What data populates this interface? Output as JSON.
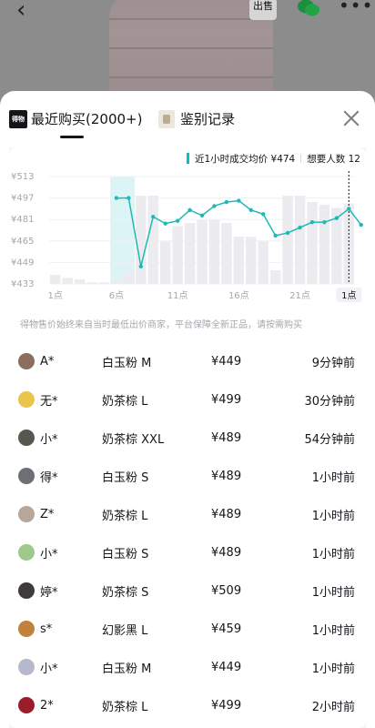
{
  "header": {
    "back_icon": "chevron-left-icon",
    "sell_label": "出售",
    "share_icon": "wechat-icon",
    "more_icon": "more-icon"
  },
  "tabs": {
    "recent": {
      "logo_text": "得物",
      "label": "最近购买(2000+)",
      "active": true
    },
    "auth": {
      "label": "鉴别记录"
    }
  },
  "chart_data": {
    "type": "line",
    "legend": {
      "avg_label": "近1小时成交均价 ¥474",
      "want_label": "想要人数 12"
    },
    "yticks": [
      "¥513",
      "¥497",
      "¥481",
      "¥465",
      "¥449",
      "¥433"
    ],
    "ylim": [
      433,
      513
    ],
    "xticks": [
      {
        "label": "1点",
        "index": 1
      },
      {
        "label": "6点",
        "index": 6
      },
      {
        "label": "11点",
        "index": 11
      },
      {
        "label": "16点",
        "index": 16
      },
      {
        "label": "21点",
        "index": 21
      },
      {
        "label": "1点",
        "index": 25
      }
    ],
    "price_line": {
      "start_index": 6,
      "values": [
        497,
        497,
        446,
        483,
        478,
        480,
        488,
        484,
        491,
        494,
        495,
        488,
        485,
        469,
        471,
        475,
        479,
        479,
        482,
        489,
        477
      ]
    },
    "volume_bars": [
      6,
      4,
      3,
      1,
      1,
      3,
      9,
      58,
      58,
      28,
      38,
      40,
      42,
      42,
      40,
      31,
      31,
      28,
      9,
      58,
      58,
      54,
      52,
      50,
      53
    ],
    "volume_max": 60,
    "highlight_start": 6,
    "highlight_end": 7,
    "current_index": 25,
    "line_color": "#1fb9b4",
    "bar_color": "#ececf0",
    "highlight_color": "#dcf4f5"
  },
  "footnote": "得物售价始终来自当时最低出价商家，平台保障全新正品，请按需购买",
  "purchases": [
    {
      "buyer": "A*",
      "spec": "白玉粉 M",
      "price": "¥449",
      "time": "9分钟前",
      "avatar_color": "#8b6f5c"
    },
    {
      "buyer": "无*",
      "spec": "奶茶棕 L",
      "price": "¥499",
      "time": "30分钟前",
      "avatar_color": "#e9c44e"
    },
    {
      "buyer": "小*",
      "spec": "奶茶棕 XXL",
      "price": "¥489",
      "time": "54分钟前",
      "avatar_color": "#57574f"
    },
    {
      "buyer": "得*",
      "spec": "白玉粉 S",
      "price": "¥489",
      "time": "1小时前",
      "avatar_color": "#6d6f76"
    },
    {
      "buyer": "Z*",
      "spec": "奶茶棕 L",
      "price": "¥489",
      "time": "1小时前",
      "avatar_color": "#b7a79a"
    },
    {
      "buyer": "小*",
      "spec": "白玉粉 S",
      "price": "¥489",
      "time": "1小时前",
      "avatar_color": "#9fc98a"
    },
    {
      "buyer": "婷*",
      "spec": "奶茶棕 S",
      "price": "¥509",
      "time": "1小时前",
      "avatar_color": "#3f3b3a"
    },
    {
      "buyer": "s*",
      "spec": "幻影黑 L",
      "price": "¥459",
      "time": "1小时前",
      "avatar_color": "#c2813c"
    },
    {
      "buyer": "小*",
      "spec": "白玉粉 M",
      "price": "¥449",
      "time": "1小时前",
      "avatar_color": "#b6b8cb"
    },
    {
      "buyer": "2*",
      "spec": "奶茶棕 L",
      "price": "¥499",
      "time": "2小时前",
      "avatar_color": "#9a1e2a"
    }
  ]
}
